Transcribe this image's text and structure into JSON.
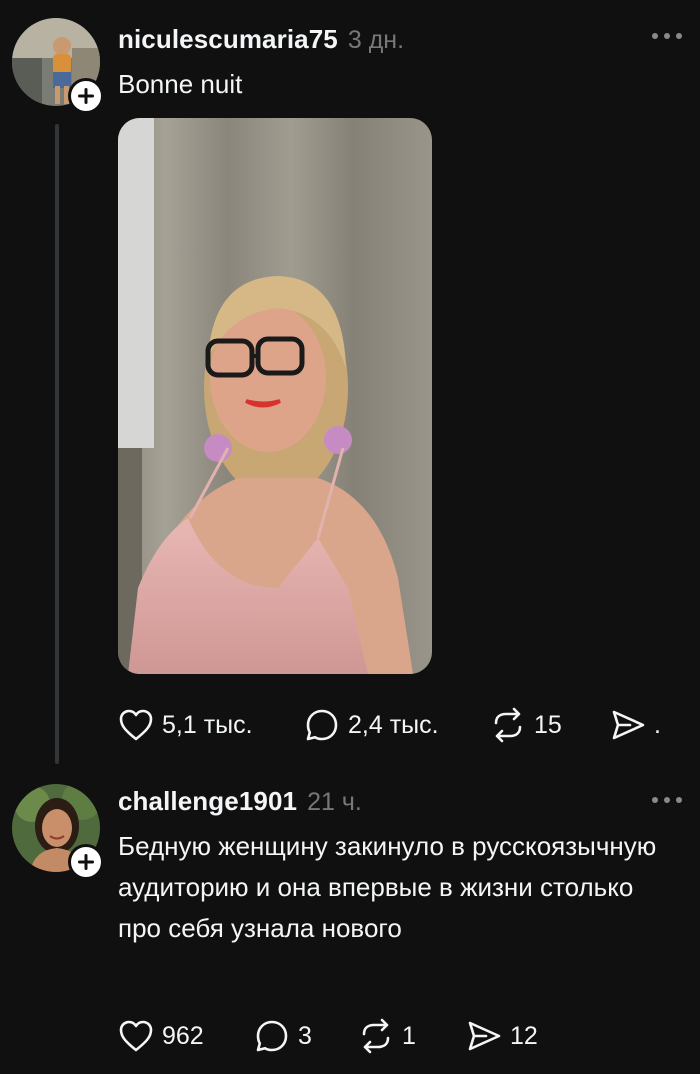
{
  "posts": [
    {
      "username": "niculescumaria75",
      "time": "3 дн.",
      "text": "Bonne nuit",
      "likes": "5,1 тыс.",
      "replies": "2,4 тыс.",
      "reposts": "15",
      "shares": "."
    },
    {
      "username": "challenge1901",
      "time": "21 ч.",
      "text": "Бедную женщину закинуло в русскоязычную аудиторию и она впервые в жизни столько про себя узнала нового",
      "likes": "962",
      "replies": "3",
      "reposts": "1",
      "shares": "12"
    }
  ],
  "icons": {
    "like": "heart-icon",
    "reply": "comment-bubble-icon",
    "repost": "repost-arrows-icon",
    "share": "send-paper-plane-icon",
    "follow": "plus-icon",
    "menu": "more-dots-icon"
  },
  "colors": {
    "background": "#101010",
    "text": "#f3f5f7",
    "muted": "#777777",
    "thread_line": "#333638"
  }
}
